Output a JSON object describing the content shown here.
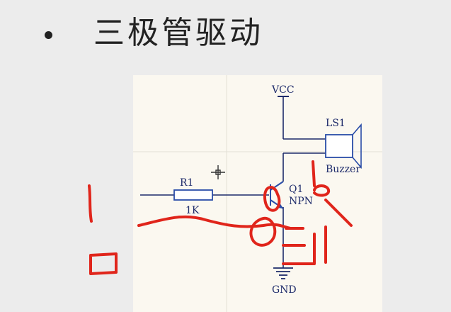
{
  "slide": {
    "bullet": "•",
    "title": "三极管驱动"
  },
  "schematic": {
    "labels": {
      "vcc": "VCC",
      "gnd": "GND",
      "resistor_ref": "R1",
      "resistor_value": "1K",
      "transistor_ref": "Q1",
      "transistor_type": "NPN",
      "speaker_ref": "LS1",
      "speaker_type": "Buzzer"
    },
    "colors": {
      "wire": "#1d2a6a",
      "component": "#2a4da8",
      "grid": "#e3e0d6",
      "annotation": "#e0251b"
    }
  }
}
